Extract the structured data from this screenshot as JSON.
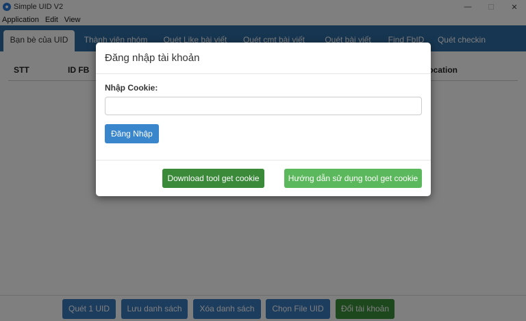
{
  "window": {
    "title": "Simple UID V2",
    "controls": {
      "minimize": "—",
      "maximize": "☐",
      "close": "✕"
    }
  },
  "menu": {
    "items": [
      "Application",
      "Edit",
      "View"
    ]
  },
  "tabs": [
    {
      "label": "Bạn bè của UID",
      "active": true
    },
    {
      "label": "Thành viên nhóm",
      "active": false
    },
    {
      "label": "Quét Like bài viết",
      "active": false
    },
    {
      "label": "Quét cmt bài viết",
      "active": false
    },
    {
      "label": "Quét bài viết",
      "active": false
    },
    {
      "label": "Find FbID",
      "active": false
    },
    {
      "label": "Quét checkin",
      "active": false
    }
  ],
  "table": {
    "columns": [
      "STT",
      "ID FB",
      "Location"
    ]
  },
  "bottom_buttons": [
    "Quét 1 UID",
    "Lưu danh sách",
    "Xóa danh sách",
    "Chọn File UID",
    "Đổi tài khoản"
  ],
  "modal": {
    "title": "Đăng nhập tài khoản",
    "cookie_label": "Nhập Cookie:",
    "cookie_value": "",
    "login_label": "Đăng Nhập",
    "download_label": "Download tool get cookie",
    "guide_label": "Hướng dẫn sử dụng tool get cookie"
  },
  "colors": {
    "tab_bar": "#2f6da3",
    "primary_button": "#3a7abf",
    "success_button": "#3b8f3b",
    "guide_button": "#5cb85c"
  }
}
